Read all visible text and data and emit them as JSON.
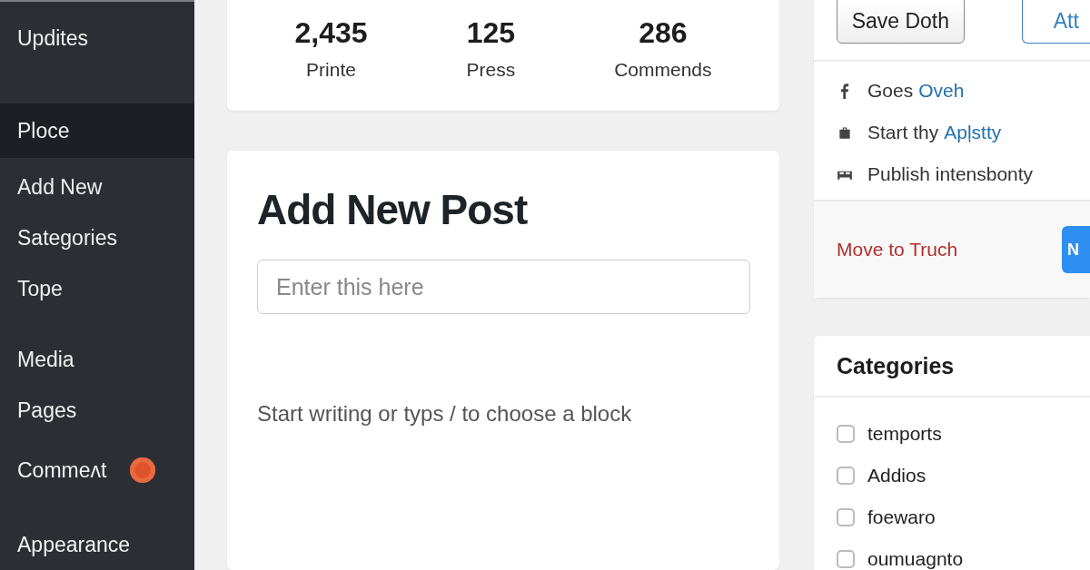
{
  "sidebar": {
    "items": [
      {
        "label": "Updites",
        "selected": false
      },
      {
        "label": "Ploce",
        "selected": true
      },
      {
        "label": "Add New",
        "selected": false
      },
      {
        "label": "Sategories",
        "selected": false
      },
      {
        "label": "Tope",
        "selected": false
      },
      {
        "label": "Media",
        "selected": false
      },
      {
        "label": "Pages",
        "selected": false
      },
      {
        "label": "Commeʌt",
        "selected": false,
        "badge": true
      },
      {
        "label": "Appearance",
        "selected": false
      }
    ]
  },
  "stats": [
    {
      "value": "2,435",
      "label": "Printe"
    },
    {
      "value": "125",
      "label": "Press"
    },
    {
      "value": "286",
      "label": "Commends"
    }
  ],
  "editor": {
    "title": "Add New Post",
    "title_field": {
      "placeholder": "Enter this here"
    },
    "body_placeholder": "Start writing or typs / to choose a block"
  },
  "publish": {
    "save_button": "Save Doth",
    "preview_button": "Att",
    "rows": [
      {
        "kind": "facebook",
        "text": "Goes",
        "link": "Oveh"
      },
      {
        "kind": "bag",
        "text": "Start thy",
        "link": "Apļstty"
      },
      {
        "kind": "bed",
        "text": "Publish intensbonty"
      }
    ],
    "trash_link": "Move to Truch",
    "publish_button": "N"
  },
  "categories": {
    "title": "Categories",
    "items": [
      {
        "label": "temports",
        "checked": false
      },
      {
        "label": "Addios",
        "checked": false
      },
      {
        "label": "foewaro",
        "checked": false
      },
      {
        "label": "oumuagnto",
        "checked": false
      }
    ]
  }
}
